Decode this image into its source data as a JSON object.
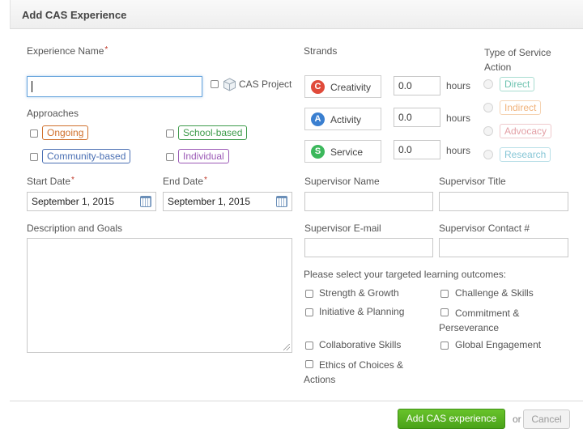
{
  "dialog": {
    "title": "Add CAS Experience"
  },
  "experience": {
    "name_label": "Experience Name",
    "required_mark": "*",
    "name_value": "",
    "cas_project_label": "CAS Project"
  },
  "approaches": {
    "label": "Approaches",
    "options": [
      {
        "label": "Ongoing",
        "color": "#d0702c"
      },
      {
        "label": "School-based",
        "color": "#3e9b4b"
      },
      {
        "label": "Community-based",
        "color": "#4a6fb3"
      },
      {
        "label": "Individual",
        "color": "#9b59b6"
      }
    ]
  },
  "dates": {
    "start_label": "Start Date",
    "start_value": "September 1, 2015",
    "end_label": "End Date",
    "end_value": "September 1, 2015"
  },
  "description": {
    "label": "Description and Goals",
    "value": ""
  },
  "strands": {
    "label": "Strands",
    "hours_unit": "hours",
    "items": [
      {
        "letter": "C",
        "name": "Creativity",
        "hours": "0.0",
        "color": "#e04a3a"
      },
      {
        "letter": "A",
        "name": "Activity",
        "hours": "0.0",
        "color": "#3a7fd0"
      },
      {
        "letter": "S",
        "name": "Service",
        "hours": "0.0",
        "color": "#3cb85c"
      }
    ]
  },
  "service_action": {
    "label": "Type of Service Action",
    "options": [
      {
        "label": "Direct",
        "color": "#6fc3b0"
      },
      {
        "label": "Indirect",
        "color": "#f0b27a"
      },
      {
        "label": "Advocacy",
        "color": "#e3a0a6"
      },
      {
        "label": "Research",
        "color": "#86c6d6"
      }
    ]
  },
  "supervisor": {
    "name_label": "Supervisor Name",
    "title_label": "Supervisor Title",
    "email_label": "Supervisor E-mail",
    "contact_label": "Supervisor Contact #"
  },
  "outcomes": {
    "label": "Please select your targeted learning outcomes:",
    "items": [
      "Strength & Growth",
      "Challenge & Skills",
      "Initiative & Planning",
      "Commitment & Perseverance",
      "Collaborative Skills",
      "Global Engagement",
      "Ethics of Choices & Actions"
    ]
  },
  "footer": {
    "submit_label": "Add CAS experience",
    "or_label": "or",
    "cancel_label": "Cancel"
  }
}
